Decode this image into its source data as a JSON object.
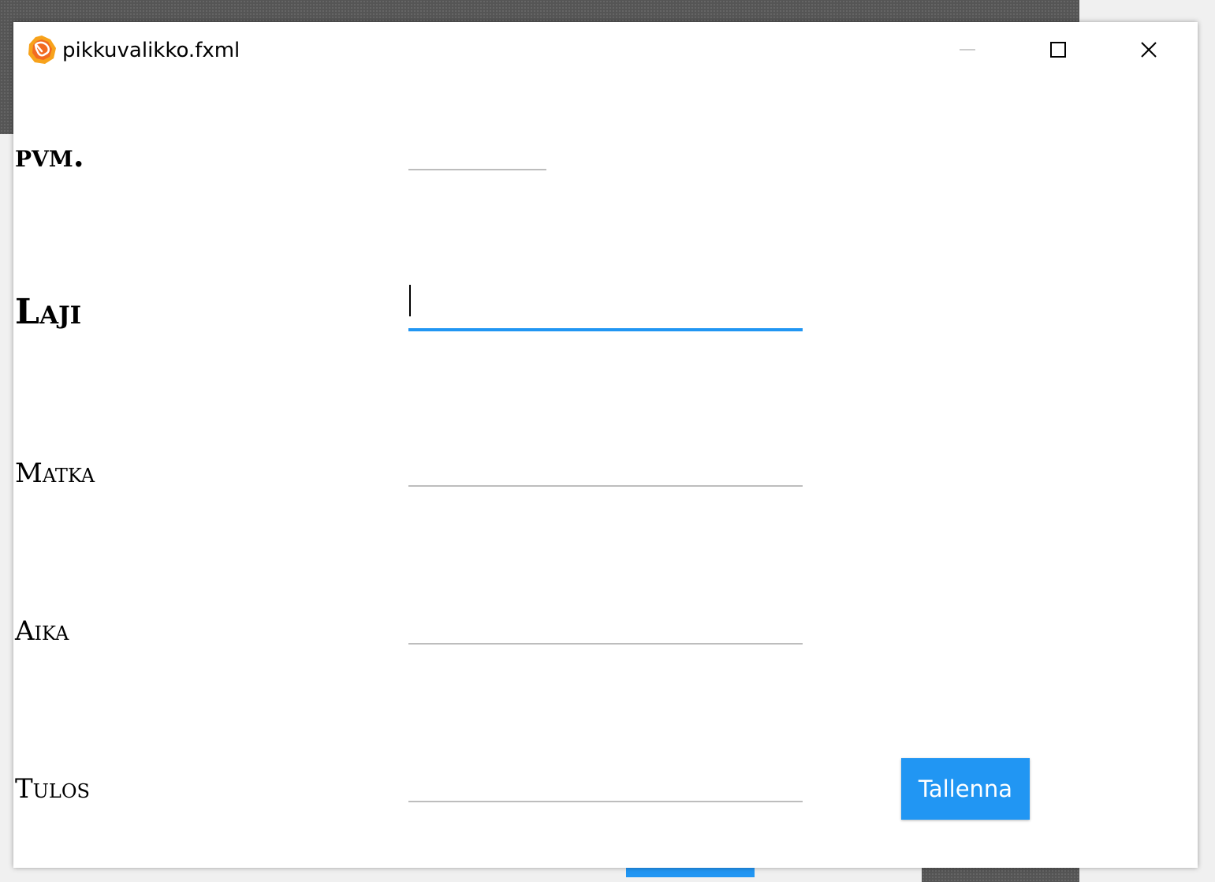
{
  "window": {
    "title": "pikkuvalikko.fxml",
    "app_icon": "java-app-icon",
    "controls": {
      "minimize_icon": "minimize-icon",
      "maximize_icon": "maximize-icon",
      "close_icon": "close-icon"
    }
  },
  "form": {
    "fields": [
      {
        "label": "pvm.",
        "value": "",
        "focused": false
      },
      {
        "label": "Laji",
        "value": "",
        "focused": true
      },
      {
        "label": "Matka",
        "value": "",
        "focused": false
      },
      {
        "label": "Aika",
        "value": "",
        "focused": false
      },
      {
        "label": "Tulos",
        "value": "",
        "focused": false
      }
    ],
    "save_label": "Tallenna"
  },
  "colors": {
    "accent": "#2196f3",
    "field_underline": "#bdbdbd",
    "button_text": "#ffffff"
  }
}
